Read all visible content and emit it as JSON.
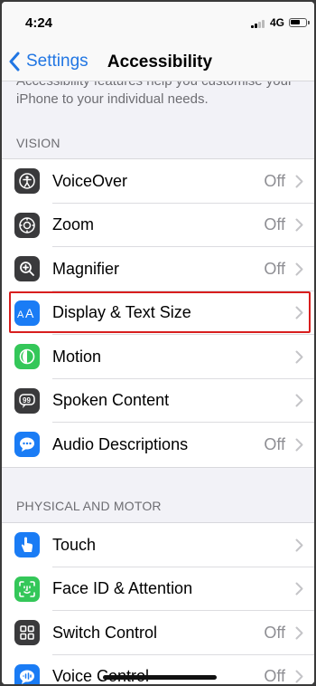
{
  "status": {
    "time": "4:24",
    "network": "4G"
  },
  "nav": {
    "back_label": "Settings",
    "title": "Accessibility"
  },
  "intro": "Accessibility features help you customise your iPhone to your individual needs.",
  "sections": [
    {
      "header": "VISION",
      "items": [
        {
          "label": "VoiceOver",
          "value": "Off",
          "icon": "voiceover-icon",
          "color": "#3a3a3c"
        },
        {
          "label": "Zoom",
          "value": "Off",
          "icon": "zoom-icon",
          "color": "#3a3a3c"
        },
        {
          "label": "Magnifier",
          "value": "Off",
          "icon": "magnifier-icon",
          "color": "#3a3a3c"
        },
        {
          "label": "Display & Text Size",
          "value": "",
          "icon": "display-text-size-icon",
          "color": "#1a7cf5"
        },
        {
          "label": "Motion",
          "value": "",
          "icon": "motion-icon",
          "color": "#34c759"
        },
        {
          "label": "Spoken Content",
          "value": "",
          "icon": "spoken-content-icon",
          "color": "#3a3a3c"
        },
        {
          "label": "Audio Descriptions",
          "value": "Off",
          "icon": "audio-descriptions-icon",
          "color": "#1a7cf5"
        }
      ]
    },
    {
      "header": "PHYSICAL AND MOTOR",
      "items": [
        {
          "label": "Touch",
          "value": "",
          "icon": "touch-icon",
          "color": "#1a7cf5"
        },
        {
          "label": "Face ID & Attention",
          "value": "",
          "icon": "face-id-icon",
          "color": "#34c759"
        },
        {
          "label": "Switch Control",
          "value": "Off",
          "icon": "switch-control-icon",
          "color": "#3a3a3c"
        },
        {
          "label": "Voice Control",
          "value": "Off",
          "icon": "voice-control-icon",
          "color": "#1a7cf5"
        }
      ]
    }
  ],
  "colors": {
    "accent": "#2176e3",
    "highlight": "#d81e1e"
  }
}
